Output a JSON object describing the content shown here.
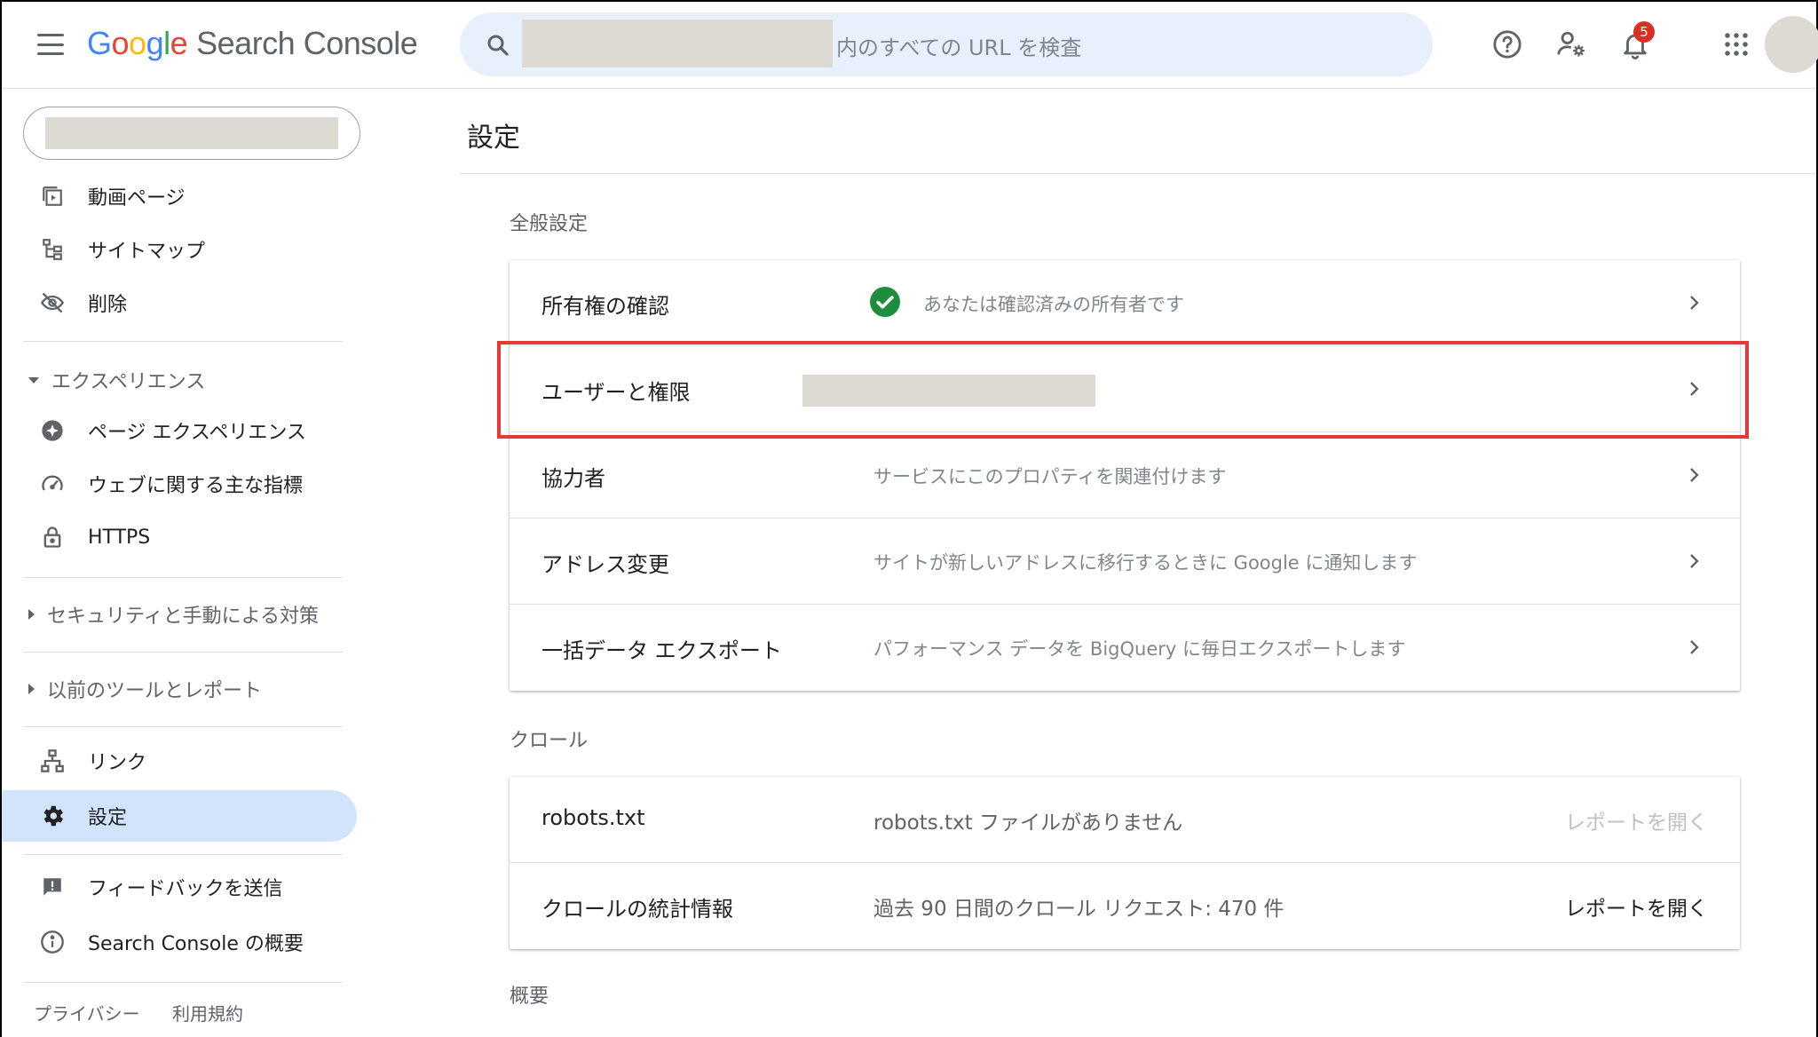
{
  "header": {
    "logo_google": [
      "G",
      "o",
      "o",
      "g",
      "l",
      "e"
    ],
    "logo_product": "Search Console",
    "search_placeholder": "内のすべての URL を検査",
    "notification_count": "5"
  },
  "sidebar": {
    "items_top": [
      {
        "label": "動画ページ",
        "icon": "video-page-icon"
      },
      {
        "label": "サイトマップ",
        "icon": "sitemap-icon"
      },
      {
        "label": "削除",
        "icon": "removal-icon"
      }
    ],
    "section_experience": "エクスペリエンス",
    "items_experience": [
      {
        "label": "ページ エクスペリエンス",
        "icon": "page-experience-icon"
      },
      {
        "label": "ウェブに関する主な指標",
        "icon": "speed-gauge-icon"
      },
      {
        "label": "HTTPS",
        "icon": "lock-icon"
      }
    ],
    "section_security": "セキュリティと手動による対策",
    "section_legacy": "以前のツールとレポート",
    "items_bottom": [
      {
        "label": "リンク",
        "icon": "links-icon"
      },
      {
        "label": "設定",
        "icon": "gear-icon"
      }
    ],
    "items_footer": [
      {
        "label": "フィードバックを送信",
        "icon": "feedback-icon"
      },
      {
        "label": "Search Console の概要",
        "icon": "info-icon"
      }
    ],
    "footer_links": [
      "プライバシー",
      "利用規約"
    ]
  },
  "main": {
    "page_title": "設定",
    "general_label": "全般設定",
    "general_rows": [
      {
        "label": "所有権の確認",
        "desc": "あなたは確認済みの所有者です"
      },
      {
        "label": "ユーザーと権限",
        "desc": ""
      },
      {
        "label": "協力者",
        "desc": "サービスにこのプロパティを関連付けます"
      },
      {
        "label": "アドレス変更",
        "desc": "サイトが新しいアドレスに移行するときに Google に通知します"
      },
      {
        "label": "一括データ エクスポート",
        "desc": "パフォーマンス データを BigQuery に毎日エクスポートします"
      }
    ],
    "crawl_label": "クロール",
    "crawl_rows": [
      {
        "label": "robots.txt",
        "desc": "robots.txt ファイルがありません",
        "link": "レポートを開く"
      },
      {
        "label": "クロールの統計情報",
        "desc": "過去 90 日間のクロール リクエスト: 470 件",
        "link": "レポートを開く"
      }
    ],
    "overview_label": "概要"
  },
  "colors": {
    "accent": "#1a73e8",
    "active_nav": "#d2e3fc",
    "highlight": "#e53935",
    "verified": "#1e8e3e"
  }
}
